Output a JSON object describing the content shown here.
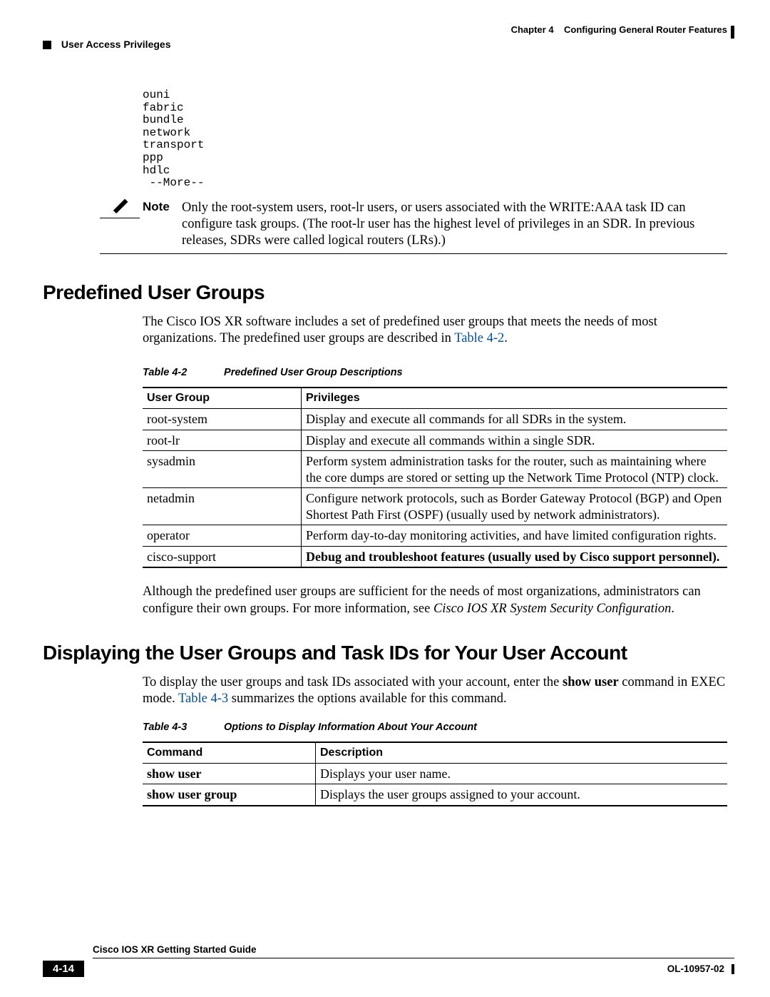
{
  "header": {
    "chapter": "Chapter 4",
    "chapter_title": "Configuring General Router Features",
    "section_nav": "User Access Privileges"
  },
  "code_output": "ouni\nfabric\nbundle\nnetwork\ntransport\nppp\nhdlc\n --More--",
  "note": {
    "label": "Note",
    "text": "Only the root-system users, root-lr users, or users associated with the WRITE:AAA task ID can configure task groups. (The root-lr user has the highest level of privileges in an SDR. In previous releases, SDRs were called logical routers (LRs).)"
  },
  "section1": {
    "heading": "Predefined User Groups",
    "para_pre": "The Cisco IOS XR software includes a set of predefined user groups that meets the needs of most organizations. The predefined user groups are described in ",
    "link": "Table 4-2",
    "para_post": ".",
    "table_num": "Table 4-2",
    "table_title": "Predefined User Group Descriptions",
    "col1": "User Group",
    "col2": "Privileges",
    "rows": [
      {
        "g": "root-system",
        "p": "Display and execute all commands for all SDRs in the system.",
        "bold": false
      },
      {
        "g": "root-lr",
        "p": "Display and execute all commands within a single SDR.",
        "bold": false
      },
      {
        "g": "sysadmin",
        "p": "Perform system administration tasks for the router, such as maintaining where the core dumps are stored or setting up the Network Time Protocol (NTP) clock.",
        "bold": false
      },
      {
        "g": "netadmin",
        "p": "Configure network protocols, such as Border Gateway Protocol (BGP) and Open Shortest Path First (OSPF) (usually used by network administrators).",
        "bold": false
      },
      {
        "g": "operator",
        "p": "Perform day-to-day monitoring activities, and have limited configuration rights.",
        "bold": false
      },
      {
        "g": "cisco-support",
        "p": "Debug and troubleshoot features (usually used by Cisco support personnel).",
        "bold": true
      }
    ],
    "after_pre": "Although the predefined user groups are sufficient for the needs of most organizations, administrators can configure their own groups. For more information, see ",
    "after_em": "Cisco IOS XR System Security Configuration",
    "after_post": "."
  },
  "section2": {
    "heading": "Displaying the User Groups and Task IDs for Your User Account",
    "para_p1": "To display the user groups and task IDs associated with your account, enter the ",
    "para_cmd": "show user",
    "para_p2": " command in EXEC mode. ",
    "link": "Table 4-3",
    "para_p3": " summarizes the options available for this command.",
    "table_num": "Table 4-3",
    "table_title": "Options to Display Information About Your Account",
    "col1": "Command",
    "col2": "Description",
    "rows": [
      {
        "c": "show user",
        "d": "Displays your user name."
      },
      {
        "c": "show user group",
        "d": "Displays the user groups assigned to your account."
      }
    ]
  },
  "footer": {
    "title": "Cisco IOS XR Getting Started Guide",
    "page_num": "4-14",
    "doc_id": "OL-10957-02"
  }
}
